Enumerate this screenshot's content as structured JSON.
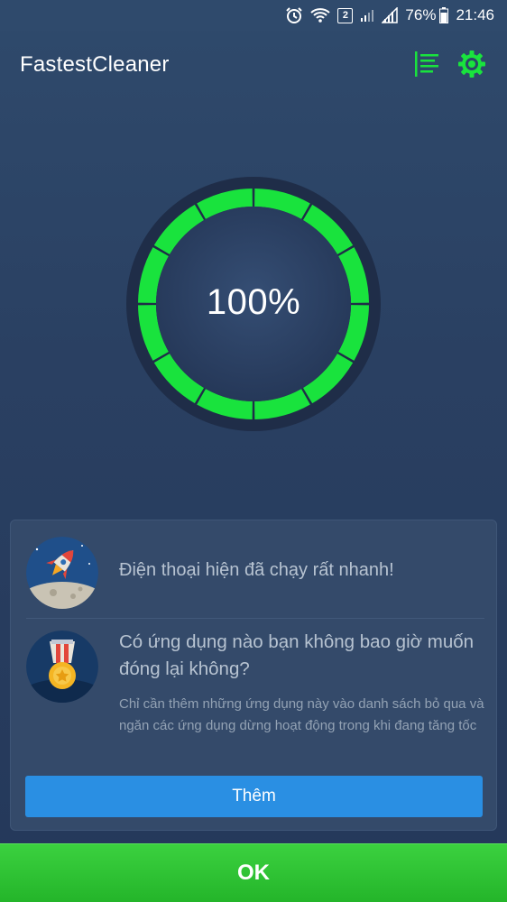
{
  "status_bar": {
    "notification_badge": "2",
    "battery": "76%",
    "time": "21:46",
    "icons": [
      "alarm-icon",
      "wifi-icon",
      "signal-icon",
      "signal-icon",
      "battery-icon"
    ]
  },
  "app_bar": {
    "title": "FastestCleaner",
    "icons": [
      "list-menu-icon",
      "settings-gear-icon"
    ],
    "accent_color": "#19e33d"
  },
  "gauge": {
    "value_label": "100%",
    "progress_percent": 100,
    "segments": 12,
    "fill_color": "#19e33d",
    "track_color": "#1f2d48"
  },
  "card": {
    "items": [
      {
        "icon": "rocket-moon-icon",
        "text": "Điện thoại hiện đã chạy rất nhanh!"
      },
      {
        "icon": "medal-icon",
        "title": "Có ứng dụng nào bạn không bao giờ muốn đóng lại không?",
        "description": "Chỉ cần thêm những ứng dụng này vào danh sách bỏ qua và ngăn các ứng dụng dừng hoạt động trong khi đang tăng tốc"
      }
    ],
    "add_button": "Thêm",
    "add_button_color": "#2a8fe3"
  },
  "ok_button": {
    "label": "OK",
    "color": "#2fbf34"
  }
}
